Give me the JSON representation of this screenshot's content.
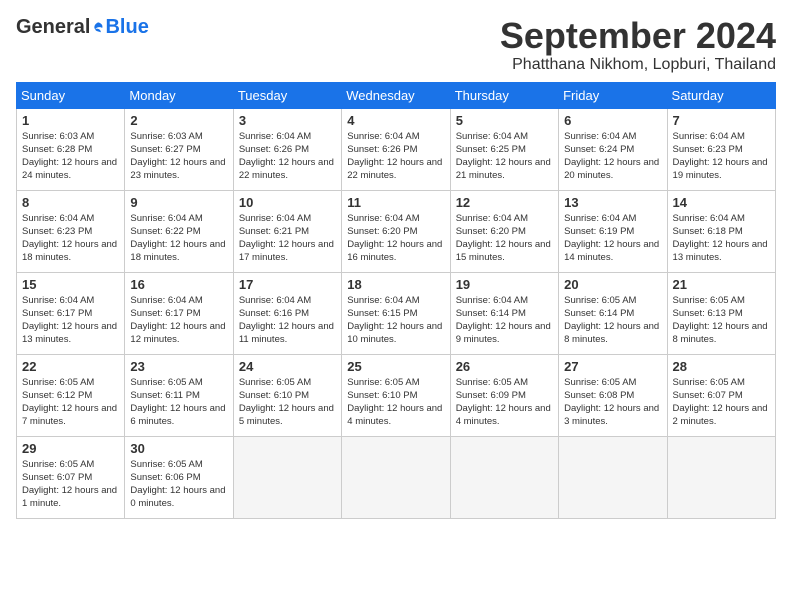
{
  "header": {
    "logo_general": "General",
    "logo_blue": "Blue",
    "month_title": "September 2024",
    "location": "Phatthana Nikhom, Lopburi, Thailand"
  },
  "weekdays": [
    "Sunday",
    "Monday",
    "Tuesday",
    "Wednesday",
    "Thursday",
    "Friday",
    "Saturday"
  ],
  "weeks": [
    [
      {
        "day": "1",
        "sunrise": "6:03 AM",
        "sunset": "6:28 PM",
        "daylight": "12 hours and 24 minutes."
      },
      {
        "day": "2",
        "sunrise": "6:03 AM",
        "sunset": "6:27 PM",
        "daylight": "12 hours and 23 minutes."
      },
      {
        "day": "3",
        "sunrise": "6:04 AM",
        "sunset": "6:26 PM",
        "daylight": "12 hours and 22 minutes."
      },
      {
        "day": "4",
        "sunrise": "6:04 AM",
        "sunset": "6:26 PM",
        "daylight": "12 hours and 22 minutes."
      },
      {
        "day": "5",
        "sunrise": "6:04 AM",
        "sunset": "6:25 PM",
        "daylight": "12 hours and 21 minutes."
      },
      {
        "day": "6",
        "sunrise": "6:04 AM",
        "sunset": "6:24 PM",
        "daylight": "12 hours and 20 minutes."
      },
      {
        "day": "7",
        "sunrise": "6:04 AM",
        "sunset": "6:23 PM",
        "daylight": "12 hours and 19 minutes."
      }
    ],
    [
      {
        "day": "8",
        "sunrise": "6:04 AM",
        "sunset": "6:23 PM",
        "daylight": "12 hours and 18 minutes."
      },
      {
        "day": "9",
        "sunrise": "6:04 AM",
        "sunset": "6:22 PM",
        "daylight": "12 hours and 18 minutes."
      },
      {
        "day": "10",
        "sunrise": "6:04 AM",
        "sunset": "6:21 PM",
        "daylight": "12 hours and 17 minutes."
      },
      {
        "day": "11",
        "sunrise": "6:04 AM",
        "sunset": "6:20 PM",
        "daylight": "12 hours and 16 minutes."
      },
      {
        "day": "12",
        "sunrise": "6:04 AM",
        "sunset": "6:20 PM",
        "daylight": "12 hours and 15 minutes."
      },
      {
        "day": "13",
        "sunrise": "6:04 AM",
        "sunset": "6:19 PM",
        "daylight": "12 hours and 14 minutes."
      },
      {
        "day": "14",
        "sunrise": "6:04 AM",
        "sunset": "6:18 PM",
        "daylight": "12 hours and 13 minutes."
      }
    ],
    [
      {
        "day": "15",
        "sunrise": "6:04 AM",
        "sunset": "6:17 PM",
        "daylight": "12 hours and 13 minutes."
      },
      {
        "day": "16",
        "sunrise": "6:04 AM",
        "sunset": "6:17 PM",
        "daylight": "12 hours and 12 minutes."
      },
      {
        "day": "17",
        "sunrise": "6:04 AM",
        "sunset": "6:16 PM",
        "daylight": "12 hours and 11 minutes."
      },
      {
        "day": "18",
        "sunrise": "6:04 AM",
        "sunset": "6:15 PM",
        "daylight": "12 hours and 10 minutes."
      },
      {
        "day": "19",
        "sunrise": "6:04 AM",
        "sunset": "6:14 PM",
        "daylight": "12 hours and 9 minutes."
      },
      {
        "day": "20",
        "sunrise": "6:05 AM",
        "sunset": "6:14 PM",
        "daylight": "12 hours and 8 minutes."
      },
      {
        "day": "21",
        "sunrise": "6:05 AM",
        "sunset": "6:13 PM",
        "daylight": "12 hours and 8 minutes."
      }
    ],
    [
      {
        "day": "22",
        "sunrise": "6:05 AM",
        "sunset": "6:12 PM",
        "daylight": "12 hours and 7 minutes."
      },
      {
        "day": "23",
        "sunrise": "6:05 AM",
        "sunset": "6:11 PM",
        "daylight": "12 hours and 6 minutes."
      },
      {
        "day": "24",
        "sunrise": "6:05 AM",
        "sunset": "6:10 PM",
        "daylight": "12 hours and 5 minutes."
      },
      {
        "day": "25",
        "sunrise": "6:05 AM",
        "sunset": "6:10 PM",
        "daylight": "12 hours and 4 minutes."
      },
      {
        "day": "26",
        "sunrise": "6:05 AM",
        "sunset": "6:09 PM",
        "daylight": "12 hours and 4 minutes."
      },
      {
        "day": "27",
        "sunrise": "6:05 AM",
        "sunset": "6:08 PM",
        "daylight": "12 hours and 3 minutes."
      },
      {
        "day": "28",
        "sunrise": "6:05 AM",
        "sunset": "6:07 PM",
        "daylight": "12 hours and 2 minutes."
      }
    ],
    [
      {
        "day": "29",
        "sunrise": "6:05 AM",
        "sunset": "6:07 PM",
        "daylight": "12 hours and 1 minute."
      },
      {
        "day": "30",
        "sunrise": "6:05 AM",
        "sunset": "6:06 PM",
        "daylight": "12 hours and 0 minutes."
      },
      null,
      null,
      null,
      null,
      null
    ]
  ]
}
